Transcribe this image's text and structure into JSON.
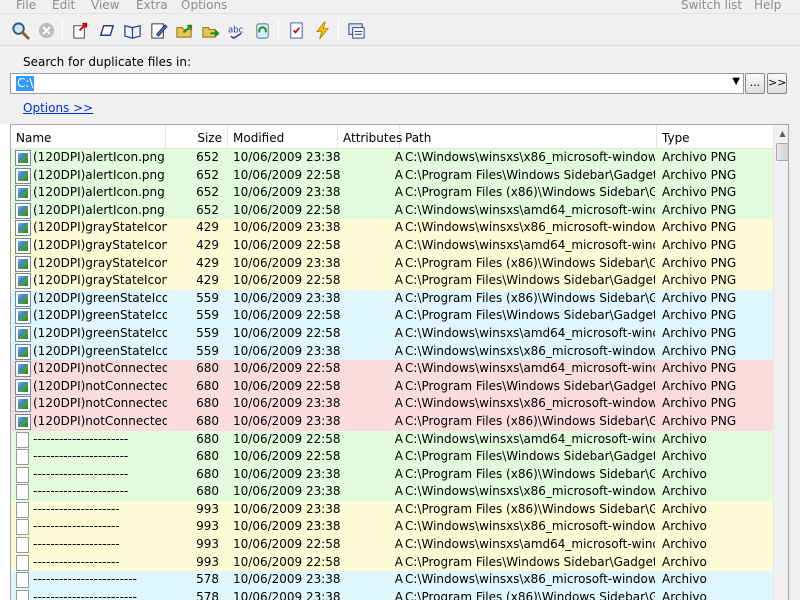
{
  "menu": {
    "items": [
      "File",
      "Edit",
      "View",
      "Extra",
      "Options"
    ],
    "right_items": [
      "Switch list",
      "Help"
    ]
  },
  "toolbar": {
    "buttons": [
      "search-icon",
      "stop-icon",
      "open-file-icon",
      "rename-icon",
      "open-folder-icon",
      "edit-icon",
      "move-icon",
      "export-icon",
      "spelling-icon",
      "recycle-icon",
      "checklist-icon",
      "lightning-icon",
      "properties-icon"
    ]
  },
  "search": {
    "label": "Search for duplicate files in:",
    "value": "C:\\",
    "browse_label": "...",
    "go_label": ">>",
    "options_link": "Options  >>"
  },
  "table": {
    "columns": [
      "Name",
      "Size",
      "Modified",
      "Attributes",
      "Path",
      "Type"
    ],
    "rows": [
      {
        "group": 0,
        "icon": "image",
        "name": "(120DPI)alertIcon.png",
        "size": "652",
        "modified": "10/06/2009  23:38",
        "attr": "A",
        "path": "C:\\Windows\\winsxs\\x86_microsoft-windows-g...",
        "type": "Archivo PNG"
      },
      {
        "group": 0,
        "icon": "image",
        "name": "(120DPI)alertIcon.png",
        "size": "652",
        "modified": "10/06/2009  22:58",
        "attr": "A",
        "path": "C:\\Program Files\\Windows Sidebar\\Gadgets\\W...",
        "type": "Archivo PNG"
      },
      {
        "group": 0,
        "icon": "image",
        "name": "(120DPI)alertIcon.png",
        "size": "652",
        "modified": "10/06/2009  23:38",
        "attr": "A",
        "path": "C:\\Program Files (x86)\\Windows Sidebar\\Gadg...",
        "type": "Archivo PNG"
      },
      {
        "group": 0,
        "icon": "image",
        "name": "(120DPI)alertIcon.png",
        "size": "652",
        "modified": "10/06/2009  22:58",
        "attr": "A",
        "path": "C:\\Windows\\winsxs\\amd64_microsoft-window...",
        "type": "Archivo PNG"
      },
      {
        "group": 1,
        "icon": "image",
        "name": "(120DPI)grayStateIcon...",
        "size": "429",
        "modified": "10/06/2009  23:38",
        "attr": "A",
        "path": "C:\\Windows\\winsxs\\x86_microsoft-windows-g...",
        "type": "Archivo PNG"
      },
      {
        "group": 1,
        "icon": "image",
        "name": "(120DPI)grayStateIcon...",
        "size": "429",
        "modified": "10/06/2009  22:58",
        "attr": "A",
        "path": "C:\\Windows\\winsxs\\amd64_microsoft-window...",
        "type": "Archivo PNG"
      },
      {
        "group": 1,
        "icon": "image",
        "name": "(120DPI)grayStateIcon...",
        "size": "429",
        "modified": "10/06/2009  23:38",
        "attr": "A",
        "path": "C:\\Program Files (x86)\\Windows Sidebar\\Gadg...",
        "type": "Archivo PNG"
      },
      {
        "group": 1,
        "icon": "image",
        "name": "(120DPI)grayStateIcon...",
        "size": "429",
        "modified": "10/06/2009  22:58",
        "attr": "A",
        "path": "C:\\Program Files\\Windows Sidebar\\Gadgets\\W...",
        "type": "Archivo PNG"
      },
      {
        "group": 2,
        "icon": "image",
        "name": "(120DPI)greenStateIco...",
        "size": "559",
        "modified": "10/06/2009  23:38",
        "attr": "A",
        "path": "C:\\Program Files (x86)\\Windows Sidebar\\Gadg...",
        "type": "Archivo PNG"
      },
      {
        "group": 2,
        "icon": "image",
        "name": "(120DPI)greenStateIco...",
        "size": "559",
        "modified": "10/06/2009  22:58",
        "attr": "A",
        "path": "C:\\Program Files\\Windows Sidebar\\Gadgets\\W...",
        "type": "Archivo PNG"
      },
      {
        "group": 2,
        "icon": "image",
        "name": "(120DPI)greenStateIco...",
        "size": "559",
        "modified": "10/06/2009  22:58",
        "attr": "A",
        "path": "C:\\Windows\\winsxs\\amd64_microsoft-window...",
        "type": "Archivo PNG"
      },
      {
        "group": 2,
        "icon": "image",
        "name": "(120DPI)greenStateIco...",
        "size": "559",
        "modified": "10/06/2009  23:38",
        "attr": "A",
        "path": "C:\\Windows\\winsxs\\x86_microsoft-windows-g...",
        "type": "Archivo PNG"
      },
      {
        "group": 3,
        "icon": "image",
        "name": "(120DPI)notConnected...",
        "size": "680",
        "modified": "10/06/2009  22:58",
        "attr": "A",
        "path": "C:\\Windows\\winsxs\\amd64_microsoft-window...",
        "type": "Archivo PNG"
      },
      {
        "group": 3,
        "icon": "image",
        "name": "(120DPI)notConnected...",
        "size": "680",
        "modified": "10/06/2009  22:58",
        "attr": "A",
        "path": "C:\\Program Files\\Windows Sidebar\\Gadgets\\W...",
        "type": "Archivo PNG"
      },
      {
        "group": 3,
        "icon": "image",
        "name": "(120DPI)notConnected...",
        "size": "680",
        "modified": "10/06/2009  23:38",
        "attr": "A",
        "path": "C:\\Windows\\winsxs\\x86_microsoft-windows-g...",
        "type": "Archivo PNG"
      },
      {
        "group": 3,
        "icon": "image",
        "name": "(120DPI)notConnected...",
        "size": "680",
        "modified": "10/06/2009  23:38",
        "attr": "A",
        "path": "C:\\Program Files (x86)\\Windows Sidebar\\Gadg...",
        "type": "Archivo PNG"
      },
      {
        "group": 0,
        "icon": "doc",
        "name": "----------------------",
        "size": "680",
        "modified": "10/06/2009  22:58",
        "attr": "A",
        "path": "C:\\Windows\\winsxs\\amd64_microsoft-window...",
        "type": "Archivo"
      },
      {
        "group": 0,
        "icon": "doc",
        "name": "----------------------",
        "size": "680",
        "modified": "10/06/2009  22:58",
        "attr": "A",
        "path": "C:\\Program Files\\Windows Sidebar\\Gadgets\\W...",
        "type": "Archivo"
      },
      {
        "group": 0,
        "icon": "doc",
        "name": "----------------------",
        "size": "680",
        "modified": "10/06/2009  23:38",
        "attr": "A",
        "path": "C:\\Program Files (x86)\\Windows Sidebar\\Gadg...",
        "type": "Archivo"
      },
      {
        "group": 0,
        "icon": "doc",
        "name": "----------------------",
        "size": "680",
        "modified": "10/06/2009  23:38",
        "attr": "A",
        "path": "C:\\Windows\\winsxs\\x86_microsoft-windows-g...",
        "type": "Archivo"
      },
      {
        "group": 1,
        "icon": "doc",
        "name": "--------------------",
        "size": "993",
        "modified": "10/06/2009  23:38",
        "attr": "A",
        "path": "C:\\Program Files (x86)\\Windows Sidebar\\Gadg...",
        "type": "Archivo"
      },
      {
        "group": 1,
        "icon": "doc",
        "name": "--------------------",
        "size": "993",
        "modified": "10/06/2009  23:38",
        "attr": "A",
        "path": "C:\\Windows\\winsxs\\x86_microsoft-windows-g...",
        "type": "Archivo"
      },
      {
        "group": 1,
        "icon": "doc",
        "name": "--------------------",
        "size": "993",
        "modified": "10/06/2009  22:58",
        "attr": "A",
        "path": "C:\\Windows\\winsxs\\amd64_microsoft-window...",
        "type": "Archivo"
      },
      {
        "group": 1,
        "icon": "doc",
        "name": "--------------------",
        "size": "993",
        "modified": "10/06/2009  22:58",
        "attr": "A",
        "path": "C:\\Program Files\\Windows Sidebar\\Gadgets\\W...",
        "type": "Archivo"
      },
      {
        "group": 2,
        "icon": "doc",
        "name": "------------------------",
        "size": "578",
        "modified": "10/06/2009  23:38",
        "attr": "A",
        "path": "C:\\Windows\\winsxs\\x86_microsoft-windows-g...",
        "type": "Archivo"
      },
      {
        "group": 2,
        "icon": "doc",
        "name": "------------------------",
        "size": "578",
        "modified": "10/06/2009  23:38",
        "attr": "A",
        "path": "C:\\Program Files (x86)\\Windows Sidebar\\Gadg...",
        "type": "Archivo"
      }
    ]
  },
  "colors": {
    "group_green": "#e2fbdc",
    "group_yellow": "#fdfad6",
    "group_blue": "#dff6fd",
    "group_red": "#fbdcdc",
    "link": "#0033cc",
    "selection": "#3399ff"
  }
}
